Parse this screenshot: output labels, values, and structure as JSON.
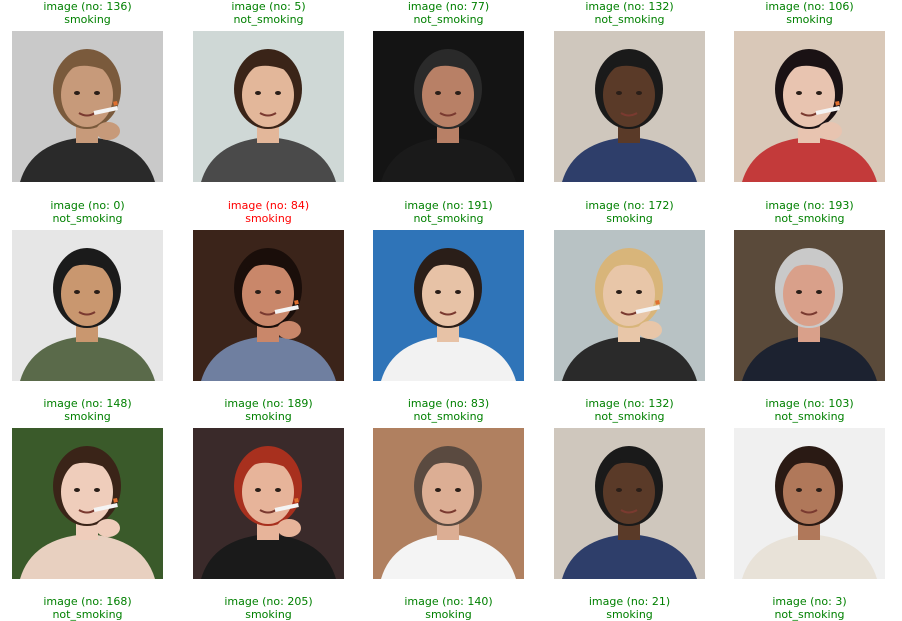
{
  "figure": {
    "rows": [
      [
        {
          "title": "image (no: 136)",
          "label": "smoking",
          "correct": true,
          "scene": {
            "bg": "#c9c9c9",
            "skin": "#c79a7a",
            "hair": "#7a5a3c",
            "clothes": "#2a2a2a",
            "cig": true
          }
        },
        {
          "title": "image (no: 5)",
          "label": "not_smoking",
          "correct": true,
          "scene": {
            "bg": "#cfd8d6",
            "skin": "#e3b79a",
            "hair": "#3a2418",
            "clothes": "#4a4a4a",
            "cig": false
          }
        },
        {
          "title": "image (no: 77)",
          "label": "not_smoking",
          "correct": true,
          "scene": {
            "bg": "#141414",
            "skin": "#b88066",
            "hair": "#2a2a2a",
            "clothes": "#1a1a1a",
            "cig": false
          }
        },
        {
          "title": "image (no: 132)",
          "label": "not_smoking",
          "correct": true,
          "scene": {
            "bg": "#cfc7bd",
            "skin": "#5a3a28",
            "hair": "#1a1a1a",
            "clothes": "#2e3e6a",
            "cig": false
          }
        },
        {
          "title": "image (no: 106)",
          "label": "smoking",
          "correct": true,
          "scene": {
            "bg": "#d9c8b8",
            "skin": "#e8c4b0",
            "hair": "#1a1214",
            "clothes": "#c33a3a",
            "cig": true
          }
        }
      ],
      [
        {
          "title": "image (no: 0)",
          "label": "not_smoking",
          "correct": true,
          "scene": {
            "bg": "#e6e6e6",
            "skin": "#c9976f",
            "hair": "#1b1b1b",
            "clothes": "#5a6a4a",
            "cig": false
          }
        },
        {
          "title": "image (no: 84)",
          "label": "smoking",
          "correct": false,
          "scene": {
            "bg": "#3b241a",
            "skin": "#c9876a",
            "hair": "#1a0e0a",
            "clothes": "#6f7fa0",
            "cig": true
          }
        },
        {
          "title": "image (no: 191)",
          "label": "not_smoking",
          "correct": true,
          "scene": {
            "bg": "#2f74b8",
            "skin": "#e7c2a6",
            "hair": "#2a1e18",
            "clothes": "#f2f2f2",
            "cig": false
          }
        },
        {
          "title": "image (no: 172)",
          "label": "smoking",
          "correct": true,
          "scene": {
            "bg": "#b8c2c4",
            "skin": "#e8c6a8",
            "hair": "#d8b57a",
            "clothes": "#2a2a2a",
            "cig": true
          }
        },
        {
          "title": "image (no: 193)",
          "label": "not_smoking",
          "correct": true,
          "scene": {
            "bg": "#5a4a3a",
            "skin": "#d9a08a",
            "hair": "#c9c9c9",
            "clothes": "#1c2230",
            "cig": false
          }
        }
      ],
      [
        {
          "title": "image (no: 148)",
          "label": "smoking",
          "correct": true,
          "scene": {
            "bg": "#3a5a2a",
            "skin": "#efcdbb",
            "hair": "#3a2418",
            "clothes": "#e8d0c0",
            "cig": true
          }
        },
        {
          "title": "image (no: 189)",
          "label": "smoking",
          "correct": true,
          "scene": {
            "bg": "#3a2a2a",
            "skin": "#e7b49a",
            "hair": "#a8301e",
            "clothes": "#1a1a1a",
            "cig": true
          }
        },
        {
          "title": "image (no: 83)",
          "label": "not_smoking",
          "correct": true,
          "scene": {
            "bg": "#b08060",
            "skin": "#dcae94",
            "hair": "#5a4a40",
            "clothes": "#f4f4f4",
            "cig": false
          }
        },
        {
          "title": "image (no: 132)",
          "label": "not_smoking",
          "correct": true,
          "scene": {
            "bg": "#cfc7bd",
            "skin": "#5a3a28",
            "hair": "#1a1a1a",
            "clothes": "#2e3e6a",
            "cig": false
          }
        },
        {
          "title": "image (no: 103)",
          "label": "not_smoking",
          "correct": true,
          "scene": {
            "bg": "#f0f0f0",
            "skin": "#b0785a",
            "hair": "#2a1a14",
            "clothes": "#e8e2d8",
            "cig": false
          }
        }
      ],
      [
        {
          "title": "image (no: 168)",
          "label": "not_smoking",
          "correct": true,
          "scene": null
        },
        {
          "title": "image (no: 205)",
          "label": "smoking",
          "correct": true,
          "scene": null
        },
        {
          "title": "image (no: 140)",
          "label": "smoking",
          "correct": true,
          "scene": null
        },
        {
          "title": "image (no: 21)",
          "label": "smoking",
          "correct": true,
          "scene": null
        },
        {
          "title": "image (no: 3)",
          "label": "not_smoking",
          "correct": true,
          "scene": null
        }
      ]
    ],
    "colors": {
      "correct": "#008000",
      "incorrect": "#ff0000"
    }
  }
}
